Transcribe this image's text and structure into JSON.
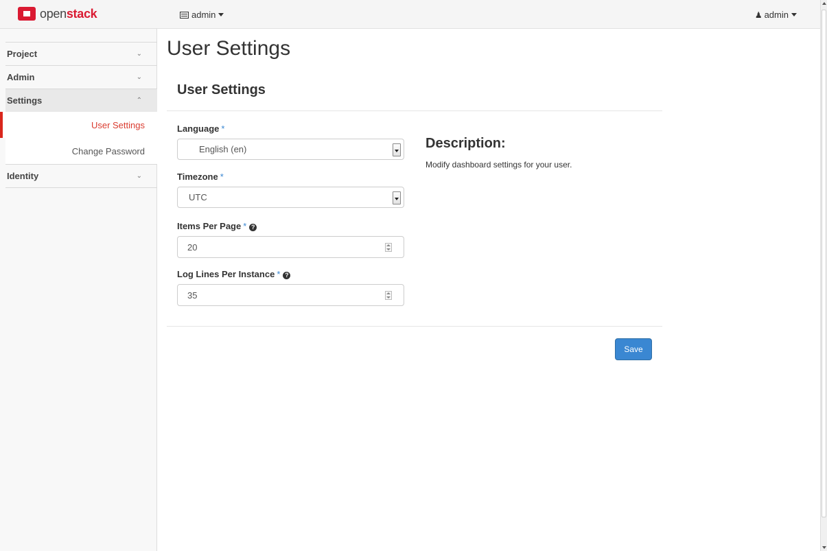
{
  "brand": {
    "prefix": "open",
    "accent": "stack",
    "logo_color": "#da1a32"
  },
  "navbar": {
    "project_menu_label": "admin",
    "user_menu_label": "admin"
  },
  "sidebar": {
    "panels": [
      {
        "label": "Project",
        "expanded": false
      },
      {
        "label": "Admin",
        "expanded": false
      },
      {
        "label": "Settings",
        "expanded": true,
        "items": [
          {
            "label": "User Settings",
            "active": true
          },
          {
            "label": "Change Password",
            "active": false
          }
        ]
      },
      {
        "label": "Identity",
        "expanded": false
      }
    ]
  },
  "main": {
    "page_title": "User Settings",
    "section_title": "User Settings",
    "fields": {
      "language": {
        "label": "Language",
        "required_marker": "*",
        "value": "English (en)"
      },
      "timezone": {
        "label": "Timezone",
        "required_marker": "*",
        "value": "UTC"
      },
      "items_per_page": {
        "label": "Items Per Page",
        "required_marker": "*",
        "value": "20"
      },
      "log_lines": {
        "label": "Log Lines Per Instance",
        "required_marker": "*",
        "value": "35"
      }
    },
    "description": {
      "title": "Description:",
      "text": "Modify dashboard settings for your user."
    },
    "save_label": "Save"
  },
  "colors": {
    "primary": "#3a87d2",
    "active_nav": "#da3b2f",
    "required": "#3a87d2"
  }
}
